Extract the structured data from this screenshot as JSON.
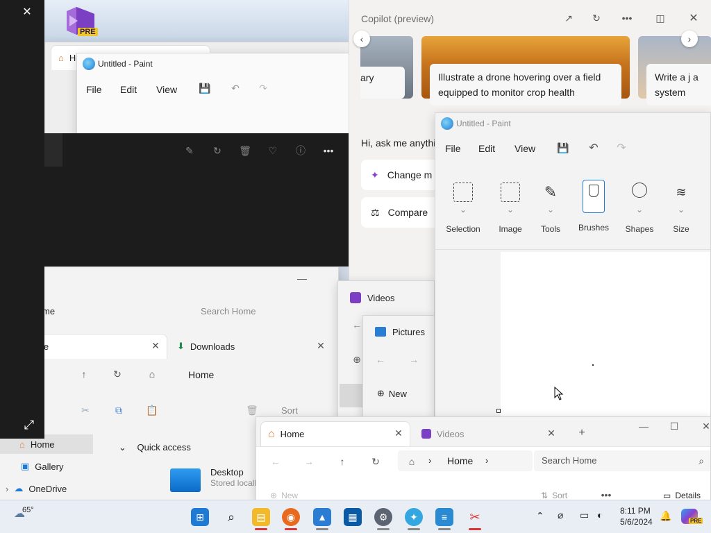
{
  "vs_badge": {
    "label": "PRE"
  },
  "explorer_back": {
    "tab_home": "Home",
    "nav_home": "Home"
  },
  "paint_back": {
    "title": "Untitled - Paint",
    "menu": [
      "File",
      "Edit",
      "View"
    ]
  },
  "photos_panel": {
    "close": "✕",
    "expand": "⤢"
  },
  "explorer_mid": {
    "search_placeholder": "Search Home",
    "crumb_partial": "me",
    "tab_home": "me",
    "tab_downloads": "Downloads",
    "breadcrumb": "Home",
    "sort": "Sort",
    "sidebar": [
      {
        "label": "Home"
      },
      {
        "label": "Gallery"
      },
      {
        "label": "OneDrive"
      }
    ],
    "quick_access": "Quick access",
    "desktop_title": "Desktop",
    "desktop_sub": "Stored locall"
  },
  "videos_win": {
    "title": "Videos"
  },
  "pictures_win": {
    "title": "Pictures",
    "new": "New"
  },
  "copilot": {
    "title": "Copilot (preview)",
    "card_left": "ary",
    "card_center": "Illustrate a drone hovering over a field equipped to monitor crop health",
    "card_right": "Write a j a system",
    "greeting": "Hi, ask me anythi",
    "chip1": "Change m",
    "chip2": "Compare"
  },
  "paint_front": {
    "title": "Untitled - Paint",
    "menu": [
      "File",
      "Edit",
      "View"
    ],
    "tools": [
      "Selection",
      "Image",
      "Tools",
      "Brushes",
      "Shapes",
      "Size"
    ]
  },
  "explorer_front": {
    "tab_home": "Home",
    "tab_videos": "Videos",
    "breadcrumb": "Home",
    "search_placeholder": "Search Home",
    "new": "New",
    "sort": "Sort",
    "details": "Details"
  },
  "taskbar": {
    "weather": "65°",
    "time": "8:11 PM",
    "date": "5/6/2024"
  },
  "colors": {
    "accent": "#0067c0",
    "dark_panel": "#1c1c1c",
    "paint_blue": "#1f7ad3"
  }
}
